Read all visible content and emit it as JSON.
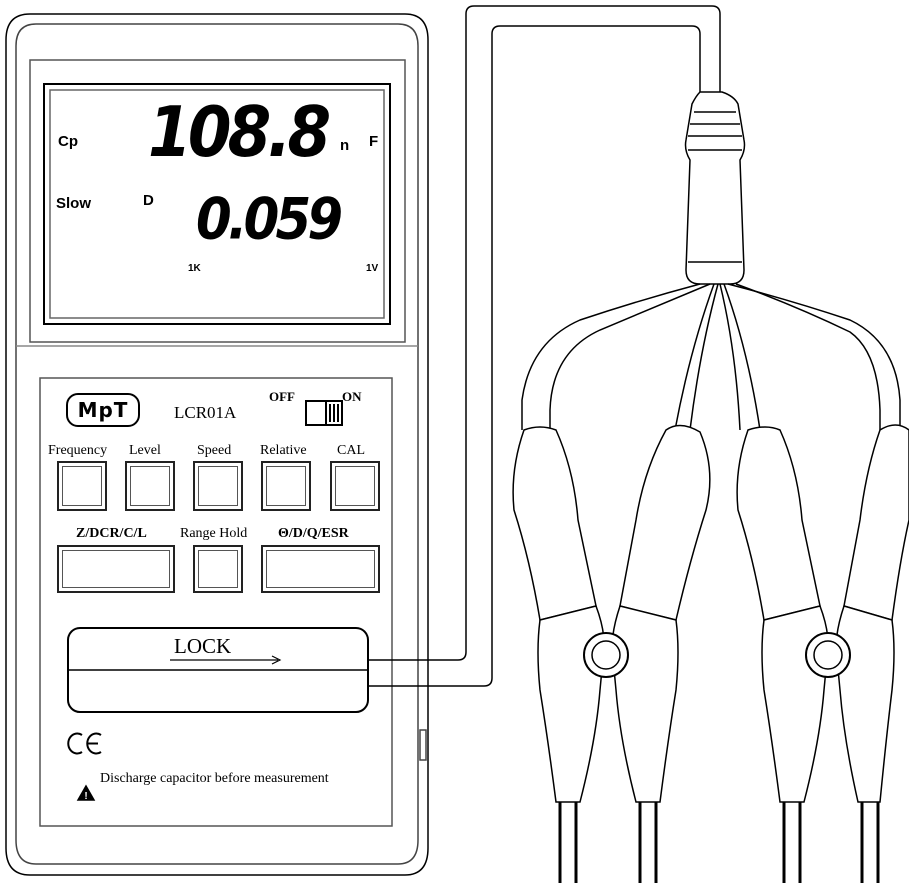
{
  "display": {
    "primary_mode": "Cp",
    "primary_value": "108.8",
    "primary_unit_prefix": "n",
    "primary_unit": "F",
    "speed": "Slow",
    "secondary_mode": "D",
    "secondary_value": "0.059",
    "frequency": "1K",
    "level": "1V"
  },
  "panel": {
    "brand": "MpT",
    "model": "LCR01A",
    "power_off": "OFF",
    "power_on": "ON",
    "buttons": {
      "frequency": "Frequency",
      "level": "Level",
      "speed": "Speed",
      "relative": "Relative",
      "cal": "CAL",
      "function": "Z/DCR/C/L",
      "range_hold": "Range Hold",
      "secondary": "Θ/D/Q/ESR"
    },
    "lock_label": "LOCK",
    "ce_mark": "CE",
    "warning": "Discharge capacitor before measurement"
  }
}
